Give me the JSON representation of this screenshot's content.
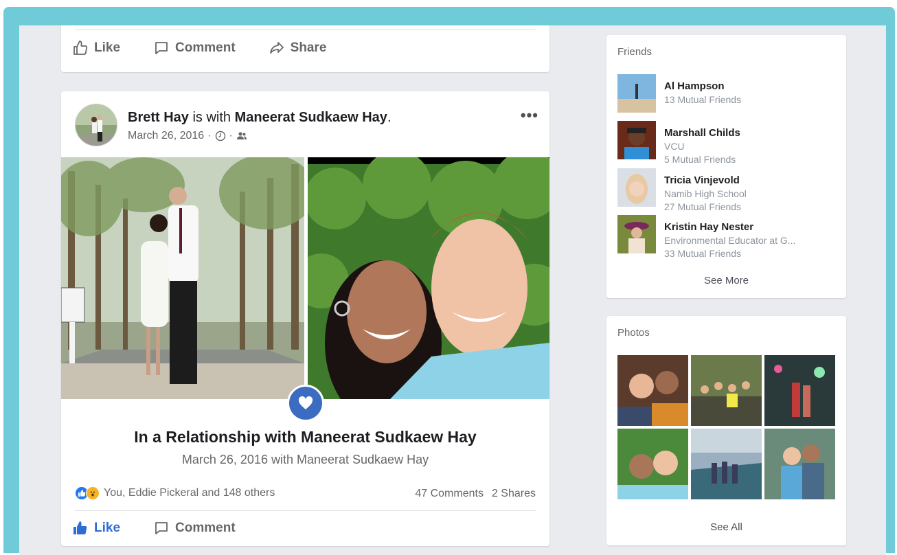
{
  "top_card": {
    "like_label": "Like",
    "comment_label": "Comment",
    "share_label": "Share"
  },
  "post": {
    "author": "Brett Hay",
    "with_text": " is with ",
    "tagged": "Maneerat Sudkaew Hay",
    "period": ".",
    "date": "March 26, 2016",
    "dot": "·",
    "more": "•••",
    "life_event_title": "In a Relationship with Maneerat Sudkaew Hay",
    "life_event_sub": "March 26, 2016 with Maneerat Sudkaew Hay",
    "reactions_text": "You, Eddie Pickeral and 148 others",
    "comments_count": "47 Comments",
    "shares_count": "2 Shares",
    "like_label": "Like",
    "comment_label": "Comment"
  },
  "friends": {
    "title": "Friends",
    "items": [
      {
        "name": "Al Hampson",
        "line2": "13 Mutual Friends",
        "line3": ""
      },
      {
        "name": "Marshall Childs",
        "line2": "VCU",
        "line3": "5 Mutual Friends"
      },
      {
        "name": "Tricia Vinjevold",
        "line2": "Namib High School",
        "line3": "27 Mutual Friends"
      },
      {
        "name": "Kristin Hay Nester",
        "line2": "Environmental Educator at G...",
        "line3": "33 Mutual Friends"
      }
    ],
    "see_more": "See More"
  },
  "photos": {
    "title": "Photos",
    "see_all": "See All"
  },
  "colors": {
    "frame": "#6fcbd8",
    "background": "#e9ebee",
    "brand_blue": "#2d6cd4",
    "heart_badge": "#3b6cc2"
  }
}
